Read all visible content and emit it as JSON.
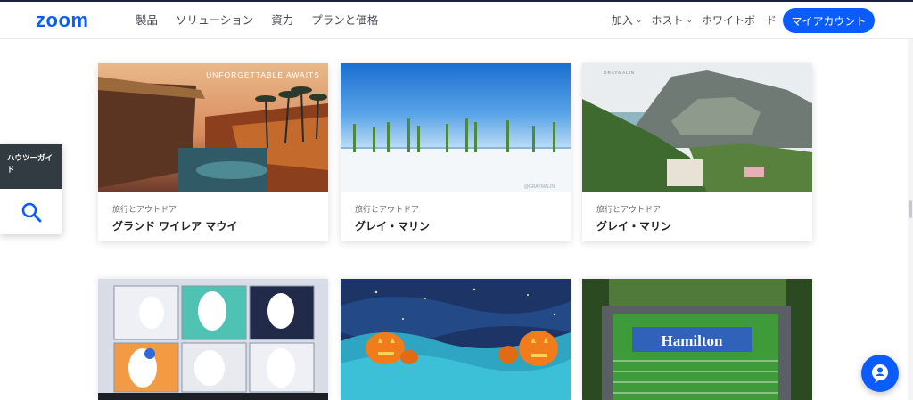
{
  "header": {
    "logo": "zoom",
    "nav": [
      "製品",
      "ソリューション",
      "資力",
      "プランと価格"
    ],
    "right_nav": [
      {
        "label": "加入",
        "dropdown": true
      },
      {
        "label": "ホスト",
        "dropdown": true
      },
      {
        "label": "ホワイトボード",
        "dropdown": false
      }
    ],
    "account_button": "マイアカウント",
    "accent": "#0b5cff"
  },
  "side_panel": {
    "label": "ハウツーガイド",
    "icon": "search-icon",
    "background": "#333b42"
  },
  "cards": [
    {
      "category": "旅行とアウトドア",
      "title": "グランド ワイレア マウイ",
      "image_text": "UNFORGETTABLE AWAITS"
    },
    {
      "category": "旅行とアウトドア",
      "title": "グレイ・マリン",
      "image_text": "@GRAYMALIN"
    },
    {
      "category": "旅行とアウトドア",
      "title": "グレイ・マリン",
      "image_text": "GRAYMALIN"
    }
  ],
  "bottom_row": [
    {
      "name": "ghosts-illustration"
    },
    {
      "name": "pumpkins-illustration"
    },
    {
      "name": "football-field-photo",
      "image_text": "Hamilton"
    }
  ],
  "chat_button": {
    "icon": "chat-bot-icon"
  }
}
